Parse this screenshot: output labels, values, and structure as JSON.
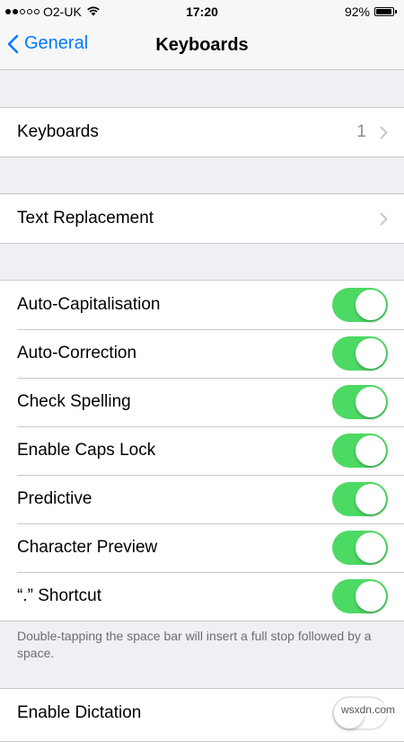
{
  "status_bar": {
    "carrier": "O2-UK",
    "time": "17:20",
    "battery": "92%",
    "battery_level": 0.92
  },
  "nav": {
    "back_label": "General",
    "title": "Keyboards"
  },
  "group_keyboards": {
    "label": "Keyboards",
    "value": "1"
  },
  "group_text": {
    "label": "Text Replacement"
  },
  "toggles": [
    {
      "label": "Auto-Capitalisation",
      "on": true
    },
    {
      "label": "Auto-Correction",
      "on": true
    },
    {
      "label": "Check Spelling",
      "on": true
    },
    {
      "label": "Enable Caps Lock",
      "on": true
    },
    {
      "label": "Predictive",
      "on": true
    },
    {
      "label": "Character Preview",
      "on": true
    },
    {
      "label": "“.” Shortcut",
      "on": true
    }
  ],
  "shortcut_note": "Double-tapping the space bar will insert a full stop followed by a space.",
  "dictation": {
    "label": "Enable Dictation",
    "on": false
  },
  "watermark": "wsxdn.com",
  "colors": {
    "accent": "#007aff",
    "toggle_on": "#4cd964",
    "background": "#efeff4"
  }
}
